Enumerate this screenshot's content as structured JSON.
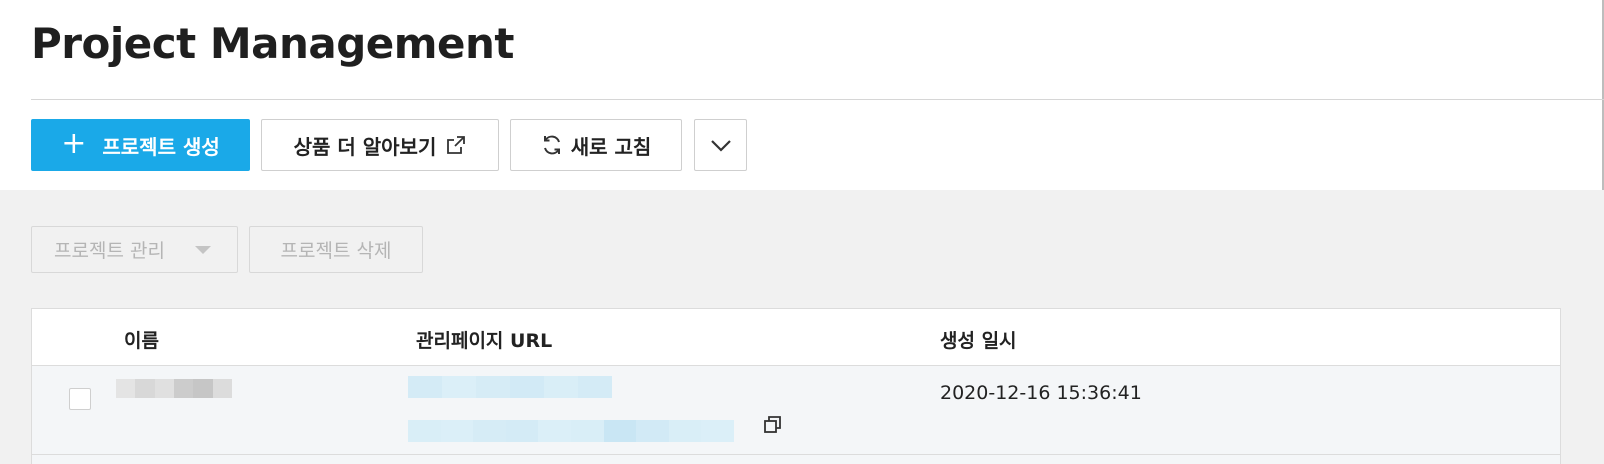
{
  "page": {
    "title": "Project Management"
  },
  "toolbar": {
    "create_label": "프로젝트 생성",
    "learn_label": "상품 더 알아보기",
    "refresh_label": "새로 고침"
  },
  "actions": {
    "manage_label": "프로젝트 관리",
    "delete_label": "프로젝트 삭제"
  },
  "table": {
    "columns": [
      "이름",
      "관리페이지 URL",
      "생성 일시"
    ],
    "rows": [
      {
        "name": "",
        "url": "",
        "created_at": "2020-12-16 15:36:41"
      }
    ]
  },
  "colors": {
    "primary": "#1aa9e8",
    "redaction_gray": [
      "#e6e6e6",
      "#d9d9d9",
      "#e2e2e2",
      "#cfcfcf",
      "#c8c8c8",
      "#dedede"
    ],
    "redaction_blue": [
      "#d6ecf6",
      "#cde8f5",
      "#d9eef7",
      "#d2eaf6",
      "#dbeff8",
      "#c9e6f4"
    ]
  },
  "icons": {
    "create": "plus-icon",
    "learn": "external-link-icon",
    "refresh": "refresh-icon",
    "more": "chevron-down-icon",
    "manage": "caret-down-icon",
    "copy": "copy-icon"
  }
}
